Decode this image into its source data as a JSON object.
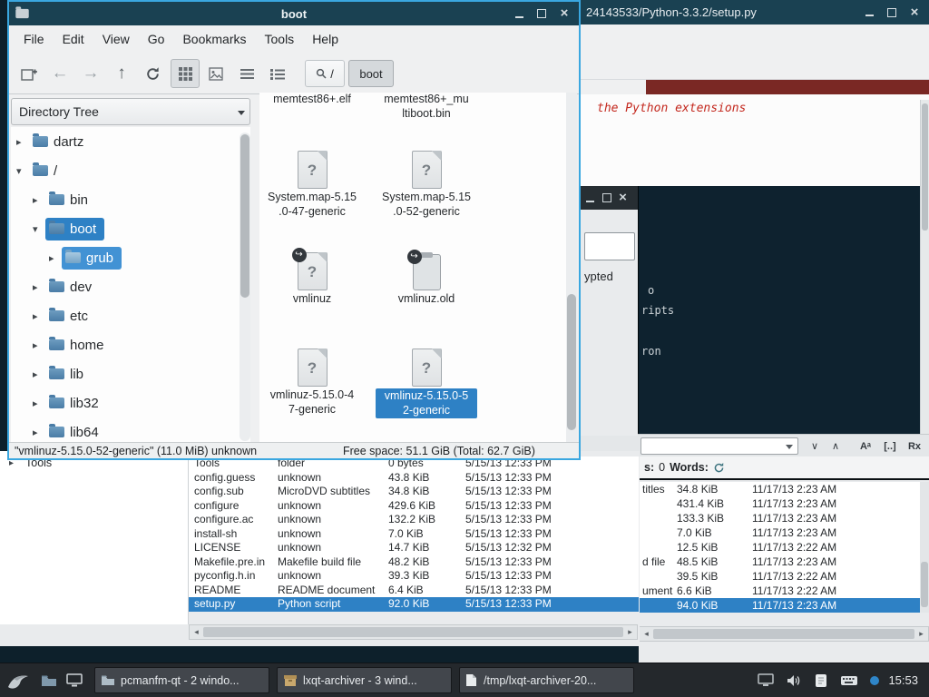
{
  "icons": {
    "close": "×",
    "tri_right": "▸",
    "tri_down": "▾",
    "arrow_back": "←",
    "arrow_forward": "→",
    "arrow_up": "↑",
    "chev_down": "∨",
    "chev_up": "∧",
    "link": "↪",
    "question": "?",
    "scroll_left": "◂",
    "scroll_right": "▸"
  },
  "file_manager": {
    "title": "boot",
    "menu_items": [
      "File",
      "Edit",
      "View",
      "Go",
      "Bookmarks",
      "Tools",
      "Help"
    ],
    "path_segments": [
      {
        "label": "/"
      },
      {
        "label": "boot"
      }
    ],
    "sidebar_mode": "Directory Tree",
    "tree": [
      {
        "label": "dartz"
      },
      {
        "label": "/"
      },
      {
        "label": "bin"
      },
      {
        "label": "boot"
      },
      {
        "label": "grub"
      },
      {
        "label": "dev"
      },
      {
        "label": "etc"
      },
      {
        "label": "home"
      },
      {
        "label": "lib"
      },
      {
        "label": "lib32"
      },
      {
        "label": "lib64"
      }
    ],
    "files": [
      {
        "l1": "memtest86+.elf"
      },
      {
        "l1": "memtest86+_mu",
        "l2": "ltiboot.bin"
      },
      {
        "l1": "System.map-5.15",
        "l2": ".0-47-generic"
      },
      {
        "l1": "System.map-5.15",
        "l2": ".0-52-generic"
      },
      {
        "l1": "vmlinuz"
      },
      {
        "l1": "vmlinuz.old"
      },
      {
        "l1": "vmlinuz-5.15.0-4",
        "l2": "7-generic"
      },
      {
        "l1": "vmlinuz-5.15.0-5",
        "l2": "2-generic"
      }
    ],
    "status_left": "\"vmlinuz-5.15.0-52-generic\" (11.0 MiB) unknown",
    "status_right": "Free space: 51.1 GiB (Total: 62.7 GiB)"
  },
  "editor": {
    "title": "24143533/Python-3.3.2/setup.py",
    "comment_text": "the Python extensions",
    "search_case": "Aᵃ",
    "search_word": "[..]",
    "search_regex": "Rx",
    "stat_sel_label": "s:",
    "stat_sel_value": "0",
    "stat_words_label": "Words:"
  },
  "terminal": {
    "line1": "o",
    "line2": "ripts",
    "line3": "ron"
  },
  "dialog": {
    "label_fragment": "ypted"
  },
  "archiver": {
    "sidebar_item": "Tools",
    "rows": [
      {
        "name": "Tools",
        "type": "folder",
        "size": "0 bytes",
        "date": "5/15/13 12:33 PM"
      },
      {
        "name": "config.guess",
        "type": "unknown",
        "size": "43.8 KiB",
        "date": "5/15/13 12:33 PM"
      },
      {
        "name": "config.sub",
        "type": "MicroDVD subtitles",
        "size": "34.8 KiB",
        "date": "5/15/13 12:33 PM"
      },
      {
        "name": "configure",
        "type": "unknown",
        "size": "429.6 KiB",
        "date": "5/15/13 12:33 PM"
      },
      {
        "name": "configure.ac",
        "type": "unknown",
        "size": "132.2 KiB",
        "date": "5/15/13 12:33 PM"
      },
      {
        "name": "install-sh",
        "type": "unknown",
        "size": "7.0 KiB",
        "date": "5/15/13 12:33 PM"
      },
      {
        "name": "LICENSE",
        "type": "unknown",
        "size": "14.7 KiB",
        "date": "5/15/13 12:32 PM"
      },
      {
        "name": "Makefile.pre.in",
        "type": "Makefile build file",
        "size": "48.2 KiB",
        "date": "5/15/13 12:33 PM"
      },
      {
        "name": "pyconfig.h.in",
        "type": "unknown",
        "size": "39.3 KiB",
        "date": "5/15/13 12:33 PM"
      },
      {
        "name": "README",
        "type": "README document",
        "size": "6.4 KiB",
        "date": "5/15/13 12:33 PM"
      },
      {
        "name": "setup.py",
        "type": "Python script",
        "size": "92.0 KiB",
        "date": "5/15/13 12:33 PM"
      }
    ]
  },
  "archiver2": {
    "rows": [
      {
        "type_fragment": "titles",
        "size": "34.8 KiB",
        "date": "11/17/13 2:23 AM"
      },
      {
        "type_fragment": "",
        "size": "431.4 KiB",
        "date": "11/17/13 2:23 AM"
      },
      {
        "type_fragment": "",
        "size": "133.3 KiB",
        "date": "11/17/13 2:23 AM"
      },
      {
        "type_fragment": "",
        "size": "7.0 KiB",
        "date": "11/17/13 2:23 AM"
      },
      {
        "type_fragment": "",
        "size": "12.5 KiB",
        "date": "11/17/13 2:22 AM"
      },
      {
        "type_fragment": "d file",
        "size": "48.5 KiB",
        "date": "11/17/13 2:23 AM"
      },
      {
        "type_fragment": "",
        "size": "39.5 KiB",
        "date": "11/17/13 2:22 AM"
      },
      {
        "type_fragment": "ument",
        "size": "6.6 KiB",
        "date": "11/17/13 2:22 AM"
      },
      {
        "type_fragment": "",
        "size": "94.0 KiB",
        "date": "11/17/13 2:23 AM"
      }
    ]
  },
  "taskbar": {
    "tasks": [
      "pcmanfm-qt - 2 windo...",
      "lxqt-archiver - 3 wind...",
      "/tmp/lxqt-archiver-20..."
    ],
    "clock": "15:53"
  }
}
